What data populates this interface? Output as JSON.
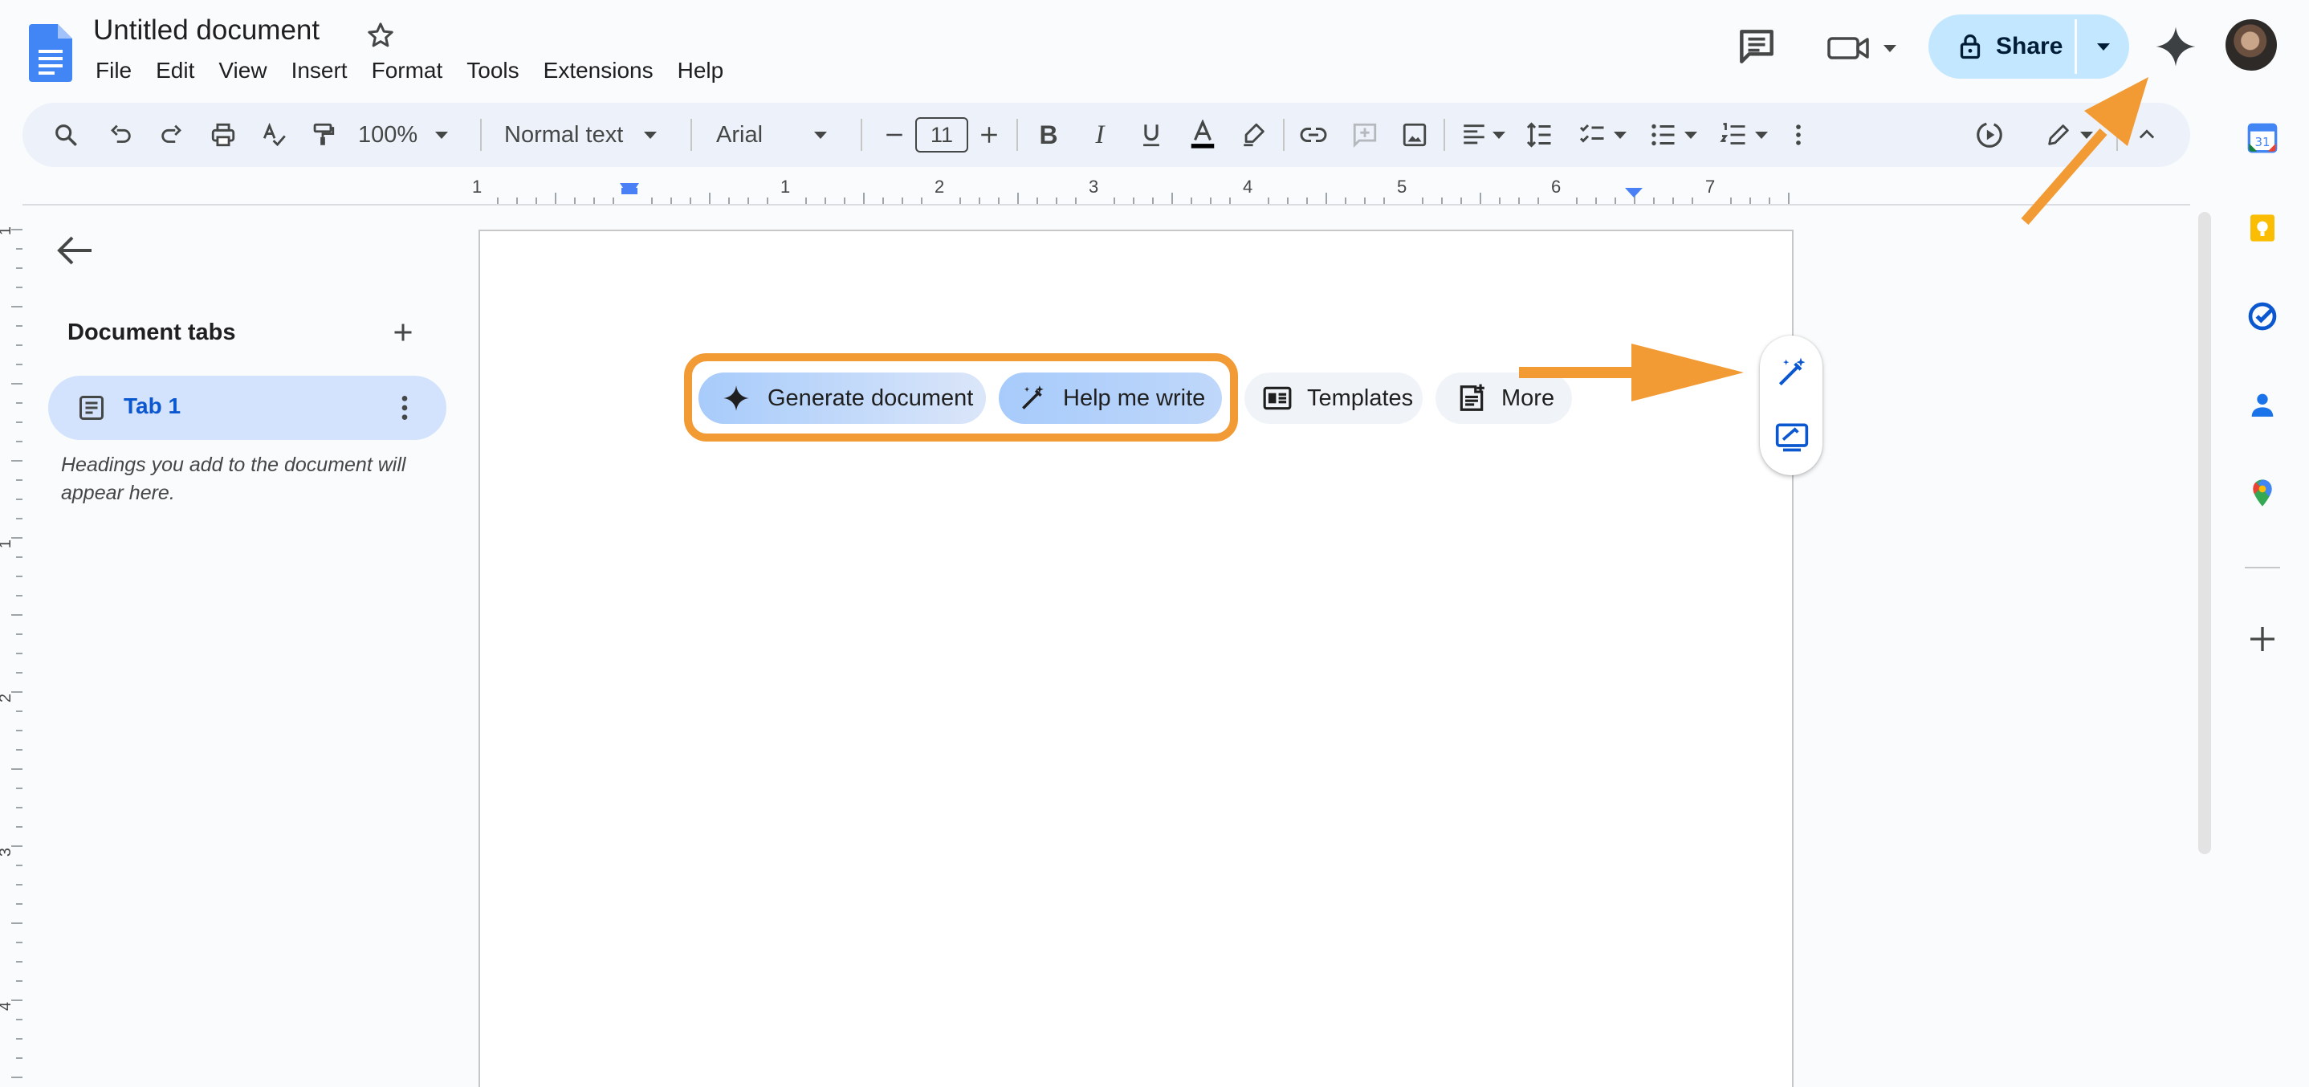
{
  "app": {
    "title": "Untitled document",
    "menu": [
      "File",
      "Edit",
      "View",
      "Insert",
      "Format",
      "Tools",
      "Extensions",
      "Help"
    ],
    "share_label": "Share"
  },
  "toolbar": {
    "zoom": "100%",
    "style": "Normal text",
    "font": "Arial",
    "font_size": "11"
  },
  "ruler": {
    "labels": [
      "1",
      "1",
      "2",
      "3",
      "4",
      "5",
      "6",
      "7"
    ],
    "vertical_labels": [
      "1",
      "1",
      "2",
      "3",
      "4"
    ]
  },
  "sidebar": {
    "title": "Document tabs",
    "tab_label": "Tab 1",
    "hint": "Headings you add to the document will appear here."
  },
  "chips": {
    "generate": "Generate document",
    "help": "Help me write",
    "templates": "Templates",
    "more": "More"
  },
  "colors": {
    "accent": "#0b57d0",
    "share_bg": "#c2e7ff",
    "annotation": "#f29a33",
    "toolbar_bg": "#edf2fa"
  },
  "icons": [
    "docs-logo-icon",
    "star-icon",
    "comment-icon",
    "meet-icon",
    "lock-icon",
    "gemini-icon",
    "search-icon",
    "undo-icon",
    "redo-icon",
    "print-icon",
    "spellcheck-icon",
    "paint-format-icon",
    "bold-icon",
    "italic-icon",
    "underline-icon",
    "text-color-icon",
    "highlight-icon",
    "link-icon",
    "add-comment-icon",
    "image-icon",
    "align-icon",
    "line-spacing-icon",
    "checklist-icon",
    "bullet-list-icon",
    "numbered-list-icon",
    "more-vert-icon",
    "editing-mode-icon",
    "collapse-icon",
    "calendar-icon",
    "keep-icon",
    "tasks-icon",
    "contacts-icon",
    "maps-icon",
    "add-icon"
  ]
}
